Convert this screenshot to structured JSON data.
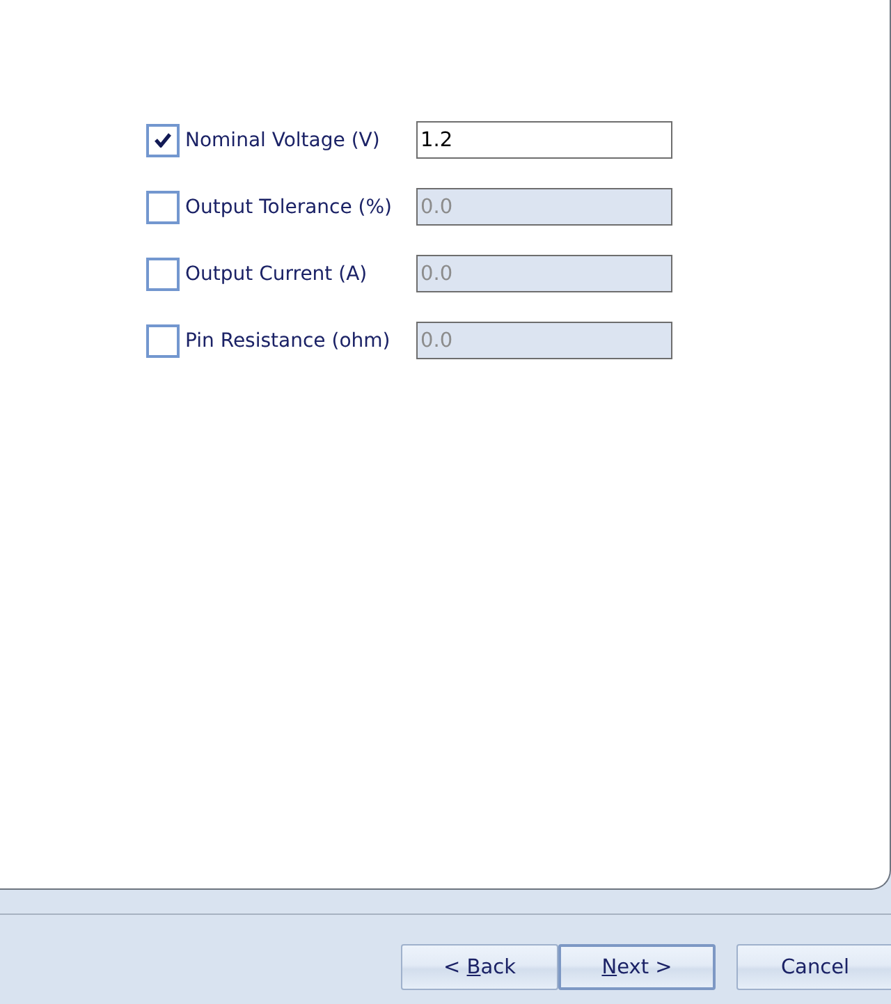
{
  "parameters": [
    {
      "label": "Nominal Voltage (V)",
      "checked": true,
      "value": "1.2",
      "disabled": false
    },
    {
      "label": "Output Tolerance (%)",
      "checked": false,
      "value": "0.0",
      "disabled": true
    },
    {
      "label": "Output Current (A)",
      "checked": false,
      "value": "0.0",
      "disabled": true
    },
    {
      "label": "Pin Resistance (ohm)",
      "checked": false,
      "value": "0.0",
      "disabled": true
    }
  ],
  "buttons": [
    {
      "before": "< ",
      "key": "B",
      "after": "ack",
      "default": false
    },
    {
      "key": "N",
      "after": "ext >",
      "default": true
    },
    {
      "before": "Cancel",
      "default": false
    }
  ]
}
